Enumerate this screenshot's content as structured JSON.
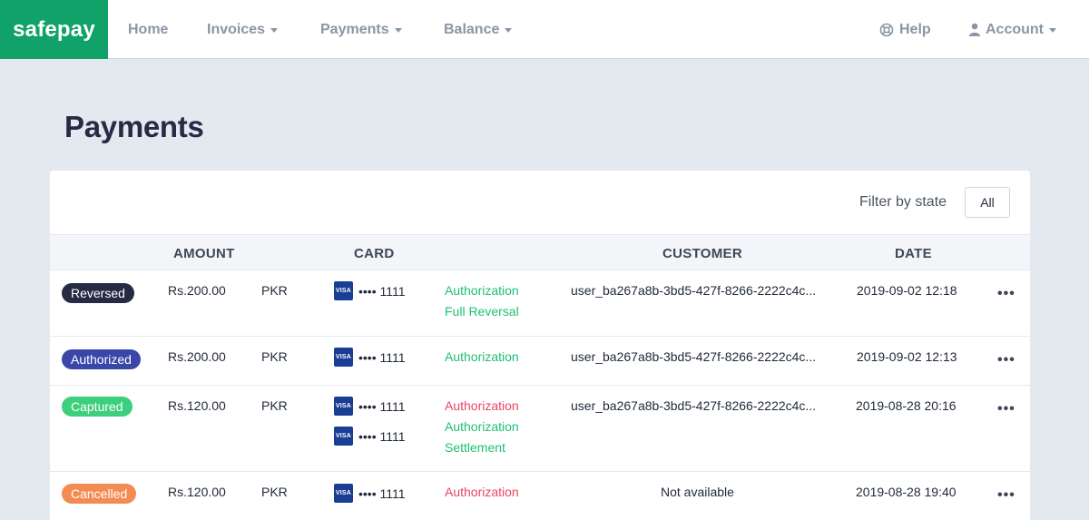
{
  "app": {
    "logo": "safepay"
  },
  "nav": {
    "home": "Home",
    "invoices": "Invoices",
    "payments": "Payments",
    "balance": "Balance",
    "help": "Help",
    "account": "Account"
  },
  "page": {
    "title": "Payments"
  },
  "filter": {
    "label": "Filter by state",
    "button": "All"
  },
  "table": {
    "headers": {
      "amount": "AMOUNT",
      "card": "CARD",
      "customer": "CUSTOMER",
      "date": "DATE"
    },
    "rows": [
      {
        "state": "Reversed",
        "amount": "Rs.200.00",
        "currency": "PKR",
        "cards": [
          {
            "brand": "VISA",
            "number": "•••• 1111"
          }
        ],
        "events": [
          {
            "label": "Authorization"
          },
          {
            "label": "Full Reversal"
          }
        ],
        "customer": "user_ba267a8b-3bd5-427f-8266-2222c4c...",
        "date": "2019-09-02 12:18",
        "more": "•••"
      },
      {
        "state": "Authorized",
        "amount": "Rs.200.00",
        "currency": "PKR",
        "cards": [
          {
            "brand": "VISA",
            "number": "•••• 1111"
          }
        ],
        "events": [
          {
            "label": "Authorization"
          }
        ],
        "customer": "user_ba267a8b-3bd5-427f-8266-2222c4c...",
        "date": "2019-09-02 12:13",
        "more": "•••"
      },
      {
        "state": "Captured",
        "amount": "Rs.120.00",
        "currency": "PKR",
        "cards": [
          {
            "brand": "VISA",
            "number": "•••• 1111"
          },
          {
            "brand": "VISA",
            "number": "•••• 1111"
          }
        ],
        "events": [
          {
            "label": "Authorization"
          },
          {
            "label": "Authorization"
          },
          {
            "label": "Settlement"
          }
        ],
        "customer": "user_ba267a8b-3bd5-427f-8266-2222c4c...",
        "date": "2019-08-28 20:16",
        "more": "•••"
      },
      {
        "state": "Cancelled",
        "amount": "Rs.120.00",
        "currency": "PKR",
        "cards": [
          {
            "brand": "VISA",
            "number": "•••• 1111"
          }
        ],
        "events": [
          {
            "label": "Authorization"
          }
        ],
        "customer": "Not available",
        "date": "2019-08-28 19:40",
        "more": "•••"
      }
    ]
  },
  "colors": {
    "brand": "#10a268",
    "reversed": "#262b45",
    "authorized": "#3a47a8",
    "captured": "#3ccf7c",
    "cancelled": "#f38c52",
    "success": "#1fbf73",
    "failure": "#e94560"
  }
}
